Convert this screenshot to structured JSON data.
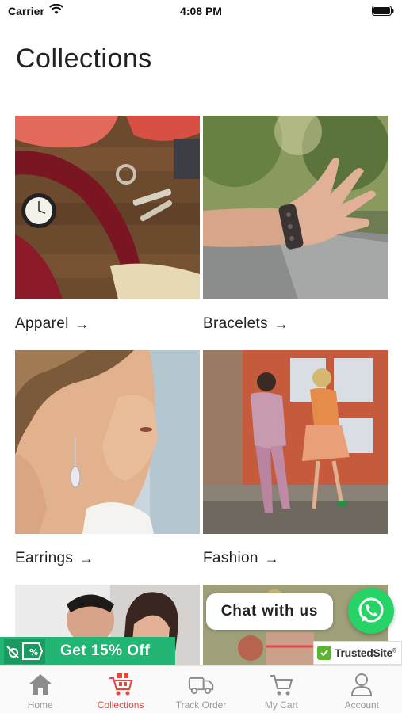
{
  "status_bar": {
    "carrier": "Carrier",
    "time": "4:08 PM"
  },
  "page": {
    "title": "Collections"
  },
  "collections": [
    {
      "label": "Apparel",
      "arrow": "→"
    },
    {
      "label": "Bracelets",
      "arrow": "→"
    },
    {
      "label": "Earrings",
      "arrow": "→"
    },
    {
      "label": "Fashion",
      "arrow": "→"
    }
  ],
  "promo": {
    "text": "Get 15% Off",
    "icon": "discount-tag-icon"
  },
  "chat": {
    "text": "Chat with us",
    "icon": "whatsapp-icon"
  },
  "trusted_site": {
    "text": "TrustedSite",
    "mark": "®"
  },
  "tab_bar": {
    "items": [
      {
        "label": "Home",
        "icon": "home-icon"
      },
      {
        "label": "Collections",
        "icon": "collections-icon"
      },
      {
        "label": "Track Order",
        "icon": "truck-icon"
      },
      {
        "label": "My Cart",
        "icon": "cart-icon"
      },
      {
        "label": "Account",
        "icon": "user-icon"
      }
    ],
    "active_index": 1
  },
  "colors": {
    "accent": "#e8443a",
    "promo": "#22b573",
    "whatsapp": "#25d366",
    "trusted": "#5cb531"
  }
}
